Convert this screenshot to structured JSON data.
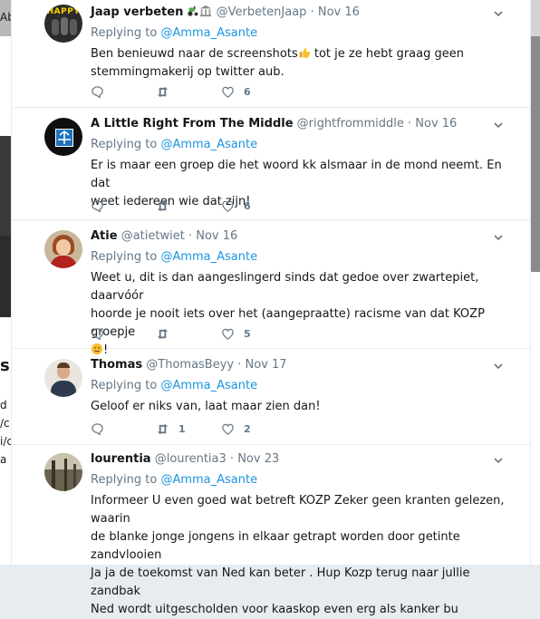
{
  "background": {
    "left_fragments": [
      "Ab",
      "s",
      "d",
      "/c",
      "i/c",
      "a n"
    ]
  },
  "tweets": [
    {
      "name": "Jaap verbeten",
      "handle": "@VerbetenJaap",
      "time": "Nov 16",
      "avatar_text": "HAPPY",
      "reply_prefix": "Replying to",
      "reply_to": "@Amma_Asante",
      "text_lines": [
        "Ben benieuwd naar de screenshots",
        " tot je ze hebt graag geen",
        "stemmingmakerij op twitter aub."
      ],
      "counts": {
        "reply": "",
        "retweet": "",
        "like": "6"
      }
    },
    {
      "name": "A Little Right From The Middle",
      "handle": "@rightfrommiddle",
      "time": "Nov 16",
      "reply_prefix": "Replying to",
      "reply_to": "@Amma_Asante",
      "text_lines": [
        "Er is maar een groep die het woord kk alsmaar in de mond neemt. En dat",
        "weet iedereen wie dat zijn!"
      ],
      "counts": {
        "reply": "",
        "retweet": "",
        "like": "6"
      }
    },
    {
      "name": "Atie",
      "handle": "@atietwiet",
      "time": "Nov 16",
      "reply_prefix": "Replying to",
      "reply_to": "@Amma_Asante",
      "text_lines": [
        "Weet u, dit is dan aangeslingerd sinds dat gedoe over zwartepiet, daarvóór",
        "hoorde je nooit iets over het (aangepraatte) racisme van dat KOZP groepje",
        "!"
      ],
      "counts": {
        "reply": "",
        "retweet": "",
        "like": "5"
      }
    },
    {
      "name": "Thomas",
      "handle": "@ThomasBeyy",
      "time": "Nov 17",
      "reply_prefix": "Replying to",
      "reply_to": "@Amma_Asante",
      "text_lines": [
        "Geloof er niks van, laat maar zien dan!"
      ],
      "counts": {
        "reply": "",
        "retweet": "1",
        "like": "2"
      }
    },
    {
      "name": "lourentia",
      "handle": "@lourentia3",
      "time": "Nov 23",
      "reply_prefix": "Replying to",
      "reply_to": "@Amma_Asante",
      "text_lines": [
        "Informeer U even goed wat betreft KOZP Zeker geen kranten gelezen, waarin",
        "de blanke jonge jongens in elkaar getrapt worden door getinte zandvlooien",
        "Ja ja de toekomst van Ned kan beter . Hup Kozp terug naar jullie zandbak",
        "Ned wordt uitgescholden voor kaaskop even erg als kanker bu"
      ],
      "counts": {
        "reply": "",
        "retweet": "",
        "like": ""
      }
    }
  ],
  "icons": {
    "reply": "reply-icon",
    "retweet": "retweet-icon",
    "like": "heart-icon",
    "more": "chevron-down-icon",
    "tractor": "tractor-emoji-icon",
    "building": "classical-building-emoji-icon",
    "thumbs": "thumbs-up-emoji-icon",
    "wink": "winking-face-emoji-icon"
  },
  "colors": {
    "link": "#1b95e0",
    "muted": "#657786",
    "text": "#14171a",
    "divider": "#e6ecf0"
  }
}
